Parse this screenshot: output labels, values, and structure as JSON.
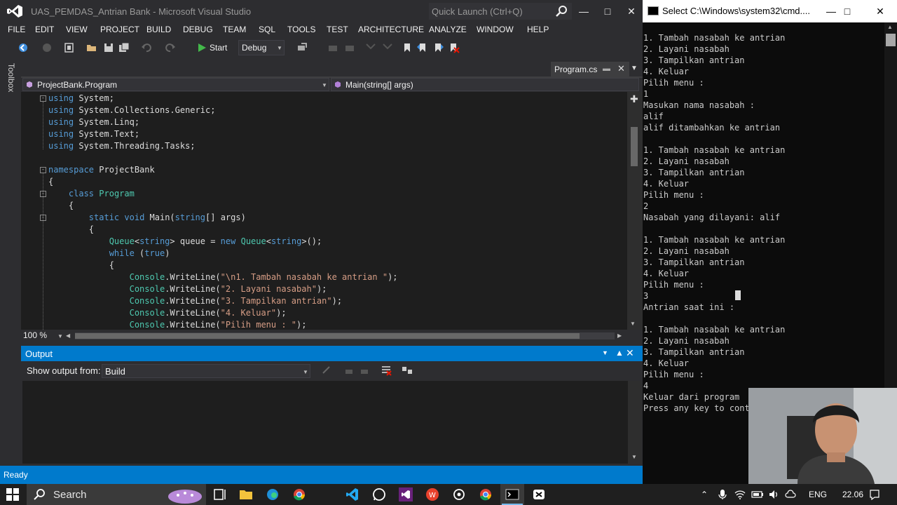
{
  "vs": {
    "title": "UAS_PEMDAS_Antrian Bank - Microsoft Visual Studio",
    "quick_launch_placeholder": "Quick Launch (Ctrl+Q)",
    "menu": [
      "FILE",
      "EDIT",
      "VIEW",
      "PROJECT",
      "BUILD",
      "DEBUG",
      "TEAM",
      "SQL",
      "TOOLS",
      "TEST",
      "ARCHITECTURE",
      "ANALYZE",
      "WINDOW",
      "HELP"
    ],
    "toolbar": {
      "start_label": "Start",
      "config": "Debug"
    },
    "toolbox_label": "Toolbox",
    "tab": {
      "label": "Program.cs"
    },
    "nav": {
      "left": "ProjectBank.Program",
      "right": "Main(string[] args)"
    },
    "zoom": "100 %",
    "output": {
      "title": "Output",
      "show_label": "Show output from:",
      "source": "Build"
    },
    "status": "Ready"
  },
  "code": {
    "lines": [
      [
        [
          "kw",
          "using"
        ],
        [
          "pl",
          " System;"
        ]
      ],
      [
        [
          "kw",
          "using"
        ],
        [
          "pl",
          " System.Collections.Generic;"
        ]
      ],
      [
        [
          "kw",
          "using"
        ],
        [
          "pl",
          " System.Linq;"
        ]
      ],
      [
        [
          "kw",
          "using"
        ],
        [
          "pl",
          " System.Text;"
        ]
      ],
      [
        [
          "kw",
          "using"
        ],
        [
          "pl",
          " System.Threading.Tasks;"
        ]
      ],
      [],
      [
        [
          "kw",
          "namespace"
        ],
        [
          "pl",
          " ProjectBank"
        ]
      ],
      [
        [
          "pl",
          "{"
        ]
      ],
      [
        [
          "pl",
          "    "
        ],
        [
          "kw",
          "class"
        ],
        [
          "pl",
          " "
        ],
        [
          "ty",
          "Program"
        ]
      ],
      [
        [
          "pl",
          "    {"
        ]
      ],
      [
        [
          "pl",
          "        "
        ],
        [
          "kw",
          "static"
        ],
        [
          "pl",
          " "
        ],
        [
          "kw",
          "void"
        ],
        [
          "pl",
          " Main("
        ],
        [
          "kw",
          "string"
        ],
        [
          "pl",
          "[] args)"
        ]
      ],
      [
        [
          "pl",
          "        {"
        ]
      ],
      [
        [
          "pl",
          "            "
        ],
        [
          "ty",
          "Queue"
        ],
        [
          "pl",
          "<"
        ],
        [
          "kw",
          "string"
        ],
        [
          "pl",
          "> queue = "
        ],
        [
          "kw",
          "new"
        ],
        [
          "pl",
          " "
        ],
        [
          "ty",
          "Queue"
        ],
        [
          "pl",
          "<"
        ],
        [
          "kw",
          "string"
        ],
        [
          "pl",
          ">();"
        ]
      ],
      [
        [
          "pl",
          "            "
        ],
        [
          "kw",
          "while"
        ],
        [
          "pl",
          " ("
        ],
        [
          "kw",
          "true"
        ],
        [
          "pl",
          ")"
        ]
      ],
      [
        [
          "pl",
          "            {"
        ]
      ],
      [
        [
          "pl",
          "                "
        ],
        [
          "ty",
          "Console"
        ],
        [
          "pl",
          ".WriteLine("
        ],
        [
          "st",
          "\"\\n1. Tambah nasabah ke antrian \""
        ],
        [
          "pl",
          ");"
        ]
      ],
      [
        [
          "pl",
          "                "
        ],
        [
          "ty",
          "Console"
        ],
        [
          "pl",
          ".WriteLine("
        ],
        [
          "st",
          "\"2. Layani nasabah\""
        ],
        [
          "pl",
          ");"
        ]
      ],
      [
        [
          "pl",
          "                "
        ],
        [
          "ty",
          "Console"
        ],
        [
          "pl",
          ".WriteLine("
        ],
        [
          "st",
          "\"3. Tampilkan antrian\""
        ],
        [
          "pl",
          ");"
        ]
      ],
      [
        [
          "pl",
          "                "
        ],
        [
          "ty",
          "Console"
        ],
        [
          "pl",
          ".WriteLine("
        ],
        [
          "st",
          "\"4. Keluar\""
        ],
        [
          "pl",
          ");"
        ]
      ],
      [
        [
          "pl",
          "                "
        ],
        [
          "ty",
          "Console"
        ],
        [
          "pl",
          ".WriteLine("
        ],
        [
          "st",
          "\"Pilih menu : \""
        ],
        [
          "pl",
          ");"
        ]
      ]
    ]
  },
  "console": {
    "title": "Select C:\\Windows\\system32\\cmd....",
    "lines": [
      "1. Tambah nasabah ke antrian",
      "2. Layani nasabah",
      "3. Tampilkan antrian",
      "4. Keluar",
      "Pilih menu :",
      "1",
      "Masukan nama nasabah :",
      "alif",
      "alif ditambahkan ke antrian",
      "",
      "1. Tambah nasabah ke antrian",
      "2. Layani nasabah",
      "3. Tampilkan antrian",
      "4. Keluar",
      "Pilih menu :",
      "2",
      "Nasabah yang dilayani: alif",
      "",
      "1. Tambah nasabah ke antrian",
      "2. Layani nasabah",
      "3. Tampilkan antrian",
      "4. Keluar",
      "Pilih menu :",
      "3",
      "Antrian saat ini :",
      "",
      "1. Tambah nasabah ke antrian",
      "2. Layani nasabah",
      "3. Tampilkan antrian",
      "4. Keluar",
      "Pilih menu :",
      "4",
      "Keluar dari program",
      "Press any key to cont"
    ]
  },
  "taskbar": {
    "search_placeholder": "Search",
    "language": "ENG",
    "time": "22.06",
    "apps": [
      "task-view",
      "file-explorer",
      "edge",
      "chrome",
      "vscode",
      "whatsapp",
      "visual-studio",
      "wps-office",
      "openai",
      "chrome-profile",
      "cmd",
      "capcut"
    ]
  },
  "colors": {
    "vs_bg": "#2d2d30",
    "editor_bg": "#1e1e1e",
    "accent": "#007acc",
    "keyword": "#569cd6",
    "type": "#4ec9b0",
    "string": "#d69d85"
  }
}
